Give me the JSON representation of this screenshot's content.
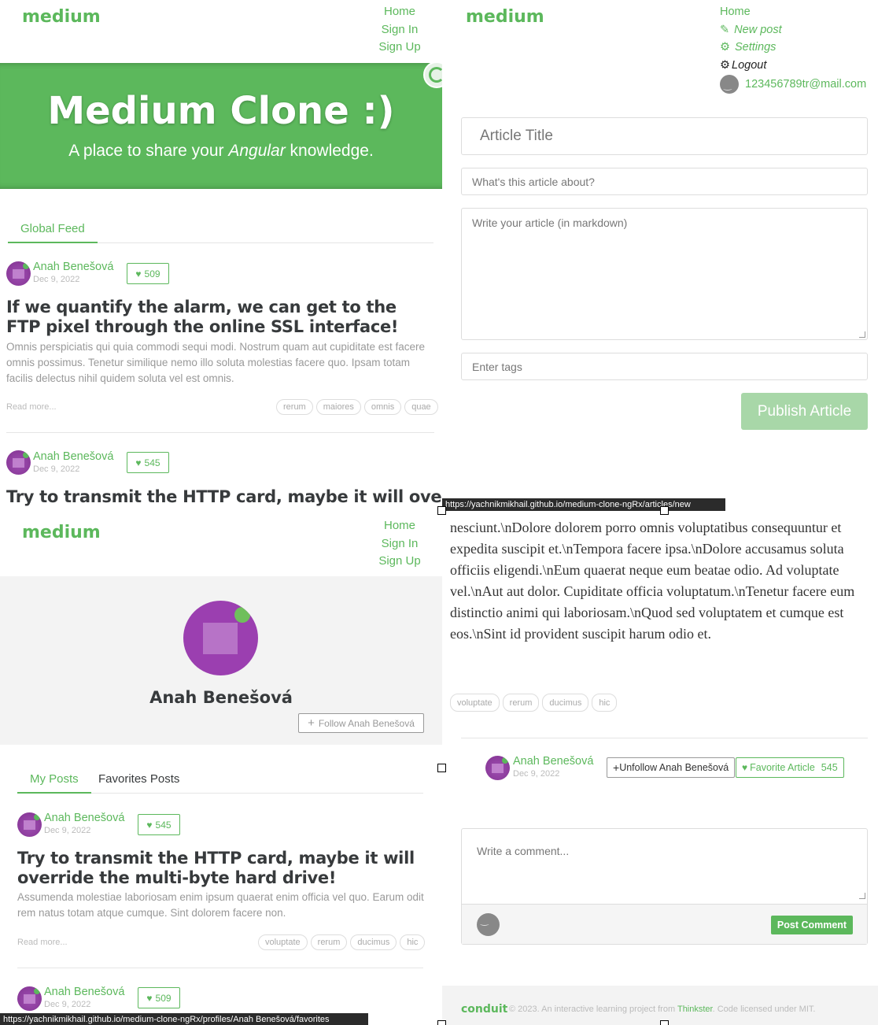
{
  "brand": "medium",
  "nav_guest": {
    "home": "Home",
    "sign_in": "Sign In",
    "sign_up": "Sign Up"
  },
  "nav_user": {
    "home": "Home",
    "new_post": "New post",
    "settings": "Settings",
    "logout": "Logout",
    "email": "123456789tr@mail.com"
  },
  "banner": {
    "title": "Medium Clone :)",
    "subtitle_pre": "A place to share your ",
    "subtitle_em": "Angular",
    "subtitle_post": " knowledge."
  },
  "home_feed": {
    "tab": "Global Feed",
    "articles": [
      {
        "author": "Anah Benešová",
        "date": "Dec 9, 2022",
        "favorites": "509",
        "title": "If we quantify the alarm, we can get to the FTP pixel through the online SSL interface!",
        "description": "Omnis perspiciatis qui quia commodi sequi modi. Nostrum quam aut cupiditate est facere omnis possimus. Tenetur similique nemo illo soluta molestias facere quo. Ipsam totam facilis delectus nihil quidem soluta vel est omnis.",
        "read_more": "Read more...",
        "tags": [
          "rerum",
          "maiores",
          "omnis",
          "quae"
        ]
      },
      {
        "author": "Anah Benešová",
        "date": "Dec 9, 2022",
        "favorites": "545",
        "title": "Try to transmit the HTTP card, maybe it will override"
      }
    ]
  },
  "editor": {
    "title_placeholder": "Article Title",
    "about_placeholder": "What's this article about?",
    "body_placeholder": "Write your article (in markdown)",
    "tags_placeholder": "Enter tags",
    "publish": "Publish Article",
    "status_url": "https://yachnikmikhail.github.io/medium-clone-ngRx/articles/new"
  },
  "profile": {
    "name": "Anah Benešová",
    "follow": "Follow Anah Benešová",
    "tabs": [
      "My Posts",
      "Favorites Posts"
    ],
    "articles": [
      {
        "author": "Anah Benešová",
        "date": "Dec 9, 2022",
        "favorites": "545",
        "title": "Try to transmit the HTTP card, maybe it will override the multi-byte hard drive!",
        "description": "Assumenda molestiae laboriosam enim ipsum quaerat enim officia vel quo. Earum odit rem natus totam atque cumque. Sint dolorem facere non.",
        "read_more": "Read more...",
        "tags": [
          "voluptate",
          "rerum",
          "ducimus",
          "hic"
        ]
      },
      {
        "author": "Anah Benešová",
        "date": "Dec 9, 2022",
        "favorites": "509"
      }
    ],
    "status_url": "https://yachnikmikhail.github.io/medium-clone-ngRx/profiles/Anah Benešová/favorites"
  },
  "article_page": {
    "body": "nesciunt.\\nDolore dolorem porro omnis voluptatibus consequuntur et expedita suscipit et.\\nTempora facere ipsa.\\nDolore accusamus soluta officiis eligendi.\\nEum quaerat neque eum beatae odio. Ad voluptate vel.\\nAut aut dolor. Cupiditate officia voluptatum.\\nTenetur facere eum distinctio animi qui laboriosam.\\nQuod sed voluptatem et cumque est eos.\\nSint id provident suscipit harum odio et.",
    "tags": [
      "voluptate",
      "rerum",
      "ducimus",
      "hic"
    ],
    "author": "Anah Benešová",
    "date": "Dec 9, 2022",
    "unfollow": "Unfollow Anah Benešová",
    "favorite": "Favorite Article",
    "favorite_count": "545",
    "comment_placeholder": "Write a comment...",
    "post_comment": "Post Comment"
  },
  "footer": {
    "logo": "conduit",
    "text_pre": "© 2023. An interactive learning project from ",
    "link": "Thinkster",
    "text_post": ". Code licensed under MIT."
  },
  "colors": {
    "accent": "#5cb85c",
    "text": "#373a3c",
    "muted": "#bbbbbb"
  }
}
